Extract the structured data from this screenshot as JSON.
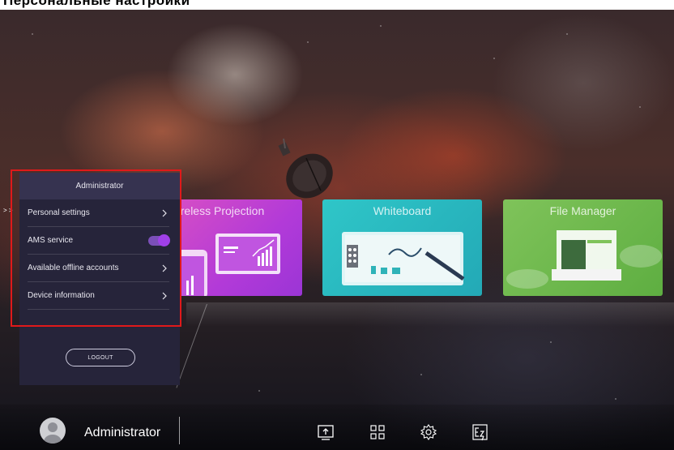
{
  "header_caption": "Персональные настройки",
  "tiles": {
    "wireless_projection": "reless Projection",
    "whiteboard": "Whiteboard",
    "file_manager": "File Manager"
  },
  "panel": {
    "title": "Administrator",
    "items": [
      {
        "label": "Personal settings",
        "control": "chevron-right"
      },
      {
        "label": "AMS service",
        "control": "toggle",
        "enabled": true
      },
      {
        "label": "Available offline accounts",
        "control": "chevron-right"
      },
      {
        "label": "Device information",
        "control": "chevron-right"
      }
    ],
    "logout_label": "LOGOUT"
  },
  "edge_tab_glyph": "> >",
  "taskbar": {
    "user_name": "Administrator",
    "icons": [
      "screen-share-icon",
      "apps-grid-icon",
      "settings-gear-icon",
      "ez-write-icon"
    ]
  },
  "colors": {
    "panel_bg": "#26243a",
    "panel_header_bg": "#363350",
    "toggle_accent": "#a040e8",
    "highlight_border": "#e0191a",
    "wireless_tile": "#b23ad8",
    "whiteboard_tile": "#23a9b6",
    "file_manager_tile": "#5eae41"
  }
}
